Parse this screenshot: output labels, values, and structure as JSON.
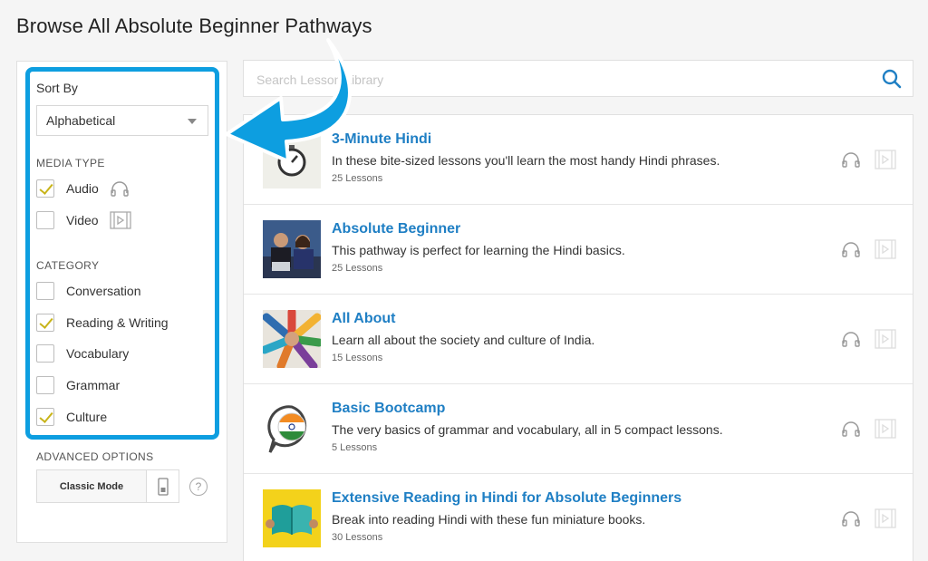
{
  "page": {
    "title": "Browse All Absolute Beginner Pathways"
  },
  "colors": {
    "accent": "#0d9ee0",
    "link": "#1f7fc4",
    "check": "#c8b41a"
  },
  "sidebar": {
    "sort_label": "Sort By",
    "sort_value": "Alphabetical",
    "media_type_heading": "MEDIA TYPE",
    "media_types": [
      {
        "label": "Audio",
        "checked": true,
        "icon": "headphones-icon"
      },
      {
        "label": "Video",
        "checked": false,
        "icon": "film-icon"
      }
    ],
    "category_heading": "CATEGORY",
    "categories": [
      {
        "label": "Conversation",
        "checked": false
      },
      {
        "label": "Reading & Writing",
        "checked": true
      },
      {
        "label": "Vocabulary",
        "checked": false
      },
      {
        "label": "Grammar",
        "checked": false
      },
      {
        "label": "Culture",
        "checked": true
      }
    ],
    "advanced_heading": "ADVANCED OPTIONS",
    "classic_mode_label": "Classic Mode",
    "help_label": "?"
  },
  "search": {
    "placeholder": "Search Lesson Library",
    "icon": "search-icon"
  },
  "pathways": [
    {
      "title": "3-Minute Hindi",
      "description": "In these bite-sized lessons you'll learn the most handy Hindi phrases.",
      "count": "25 Lessons",
      "thumb": "clock"
    },
    {
      "title": "Absolute Beginner",
      "description": "This pathway is perfect for learning the Hindi basics.",
      "count": "25 Lessons",
      "thumb": "people"
    },
    {
      "title": "All About",
      "description": "Learn all about the society and culture of India.",
      "count": "15 Lessons",
      "thumb": "hands"
    },
    {
      "title": "Basic Bootcamp",
      "description": "The very basics of grammar and vocabulary, all in 5 compact lessons.",
      "count": "5 Lessons",
      "thumb": "flag-bubble"
    },
    {
      "title": "Extensive Reading in Hindi for Absolute Beginners",
      "description": "Break into reading Hindi with these fun miniature books.",
      "count": "30 Lessons",
      "thumb": "book"
    }
  ]
}
